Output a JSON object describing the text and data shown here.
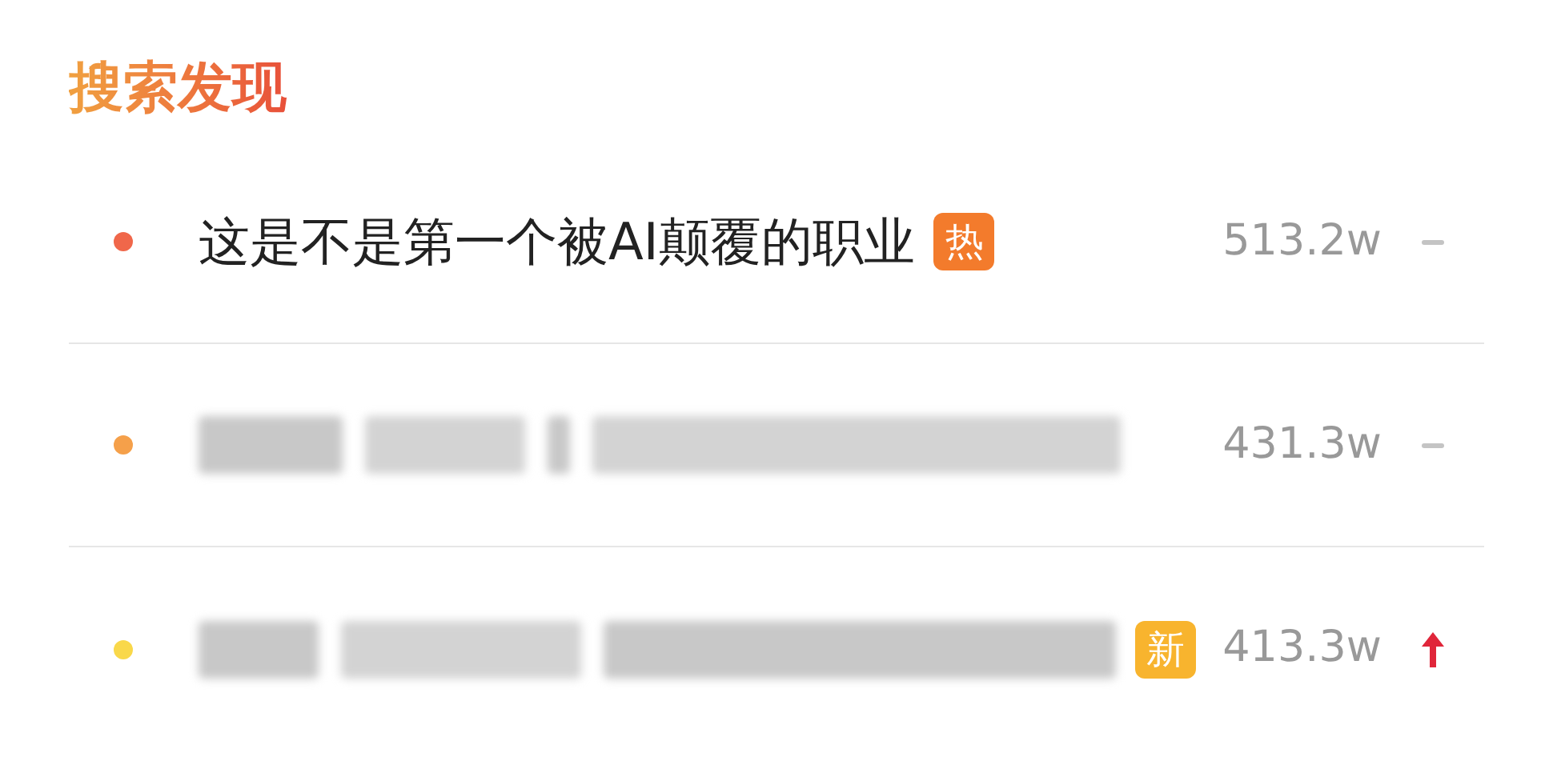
{
  "section_title": "搜索发现",
  "rows": [
    {
      "color": "#f0674a",
      "title": {
        "kind": "plain",
        "text": "这是不是第一个被AI颠覆的职业"
      },
      "badge": {
        "text": "热",
        "color": "#f37b2c"
      },
      "count": "513.2w",
      "trend": {
        "kind": "flat"
      }
    },
    {
      "color": "#f5a04a",
      "title": {
        "kind": "redacted"
      },
      "count": "431.3w",
      "trend": {
        "kind": "flat"
      }
    },
    {
      "color": "#f9d84a",
      "title": {
        "kind": "redacted"
      },
      "badge": {
        "text": "新",
        "color": "#f8b42e"
      },
      "count": "413.3w",
      "trend": {
        "kind": "up"
      }
    }
  ]
}
